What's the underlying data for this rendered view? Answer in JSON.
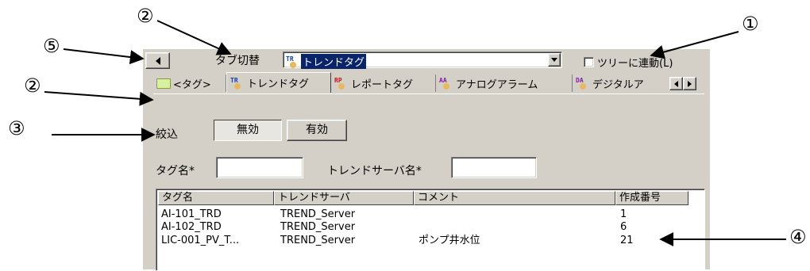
{
  "callouts": {
    "c1": "①",
    "c2": "②",
    "c3": "③",
    "c4": "④",
    "c5": "⑤"
  },
  "toolbar": {
    "back_label": "",
    "switch_label": "タブ切替",
    "tag_icon_text": "TR",
    "selected_value": "トレンドタグ",
    "sync_checkbox_label": "ツリーに連動(L)",
    "sync_checked": false
  },
  "tabs": [
    {
      "label": "<タグ>",
      "icon": "folder-icon",
      "icon_text": ""
    },
    {
      "label": "トレンドタグ",
      "icon": "trend-tag-icon",
      "icon_text": "TR"
    },
    {
      "label": "レポートタグ",
      "icon": "report-tag-icon",
      "icon_text": "RP"
    },
    {
      "label": "アナログアラーム",
      "icon": "analog-alarm-icon",
      "icon_text": "AA"
    },
    {
      "label": "デジタルア",
      "icon": "digital-alarm-icon",
      "icon_text": "DA"
    }
  ],
  "filter": {
    "label": "絞込",
    "off_label": "無効",
    "on_label": "有効",
    "tag_name_label": "タグ名*",
    "tag_name_value": "",
    "server_label": "トレンドサーバ名*",
    "server_value": ""
  },
  "list": {
    "columns": [
      "タグ名",
      "トレンドサーバ",
      "コメント",
      "作成番号"
    ],
    "rows": [
      [
        "AI-101_TRD",
        "TREND_Server",
        "",
        "1"
      ],
      [
        "AI-102_TRD",
        "TREND_Server",
        "",
        "6"
      ],
      [
        "LIC-001_PV_T...",
        "TREND_Server",
        "ポンプ井水位",
        "21"
      ]
    ]
  },
  "colors": {
    "panel": "#d4d0c8",
    "selection": "#0a246a"
  }
}
